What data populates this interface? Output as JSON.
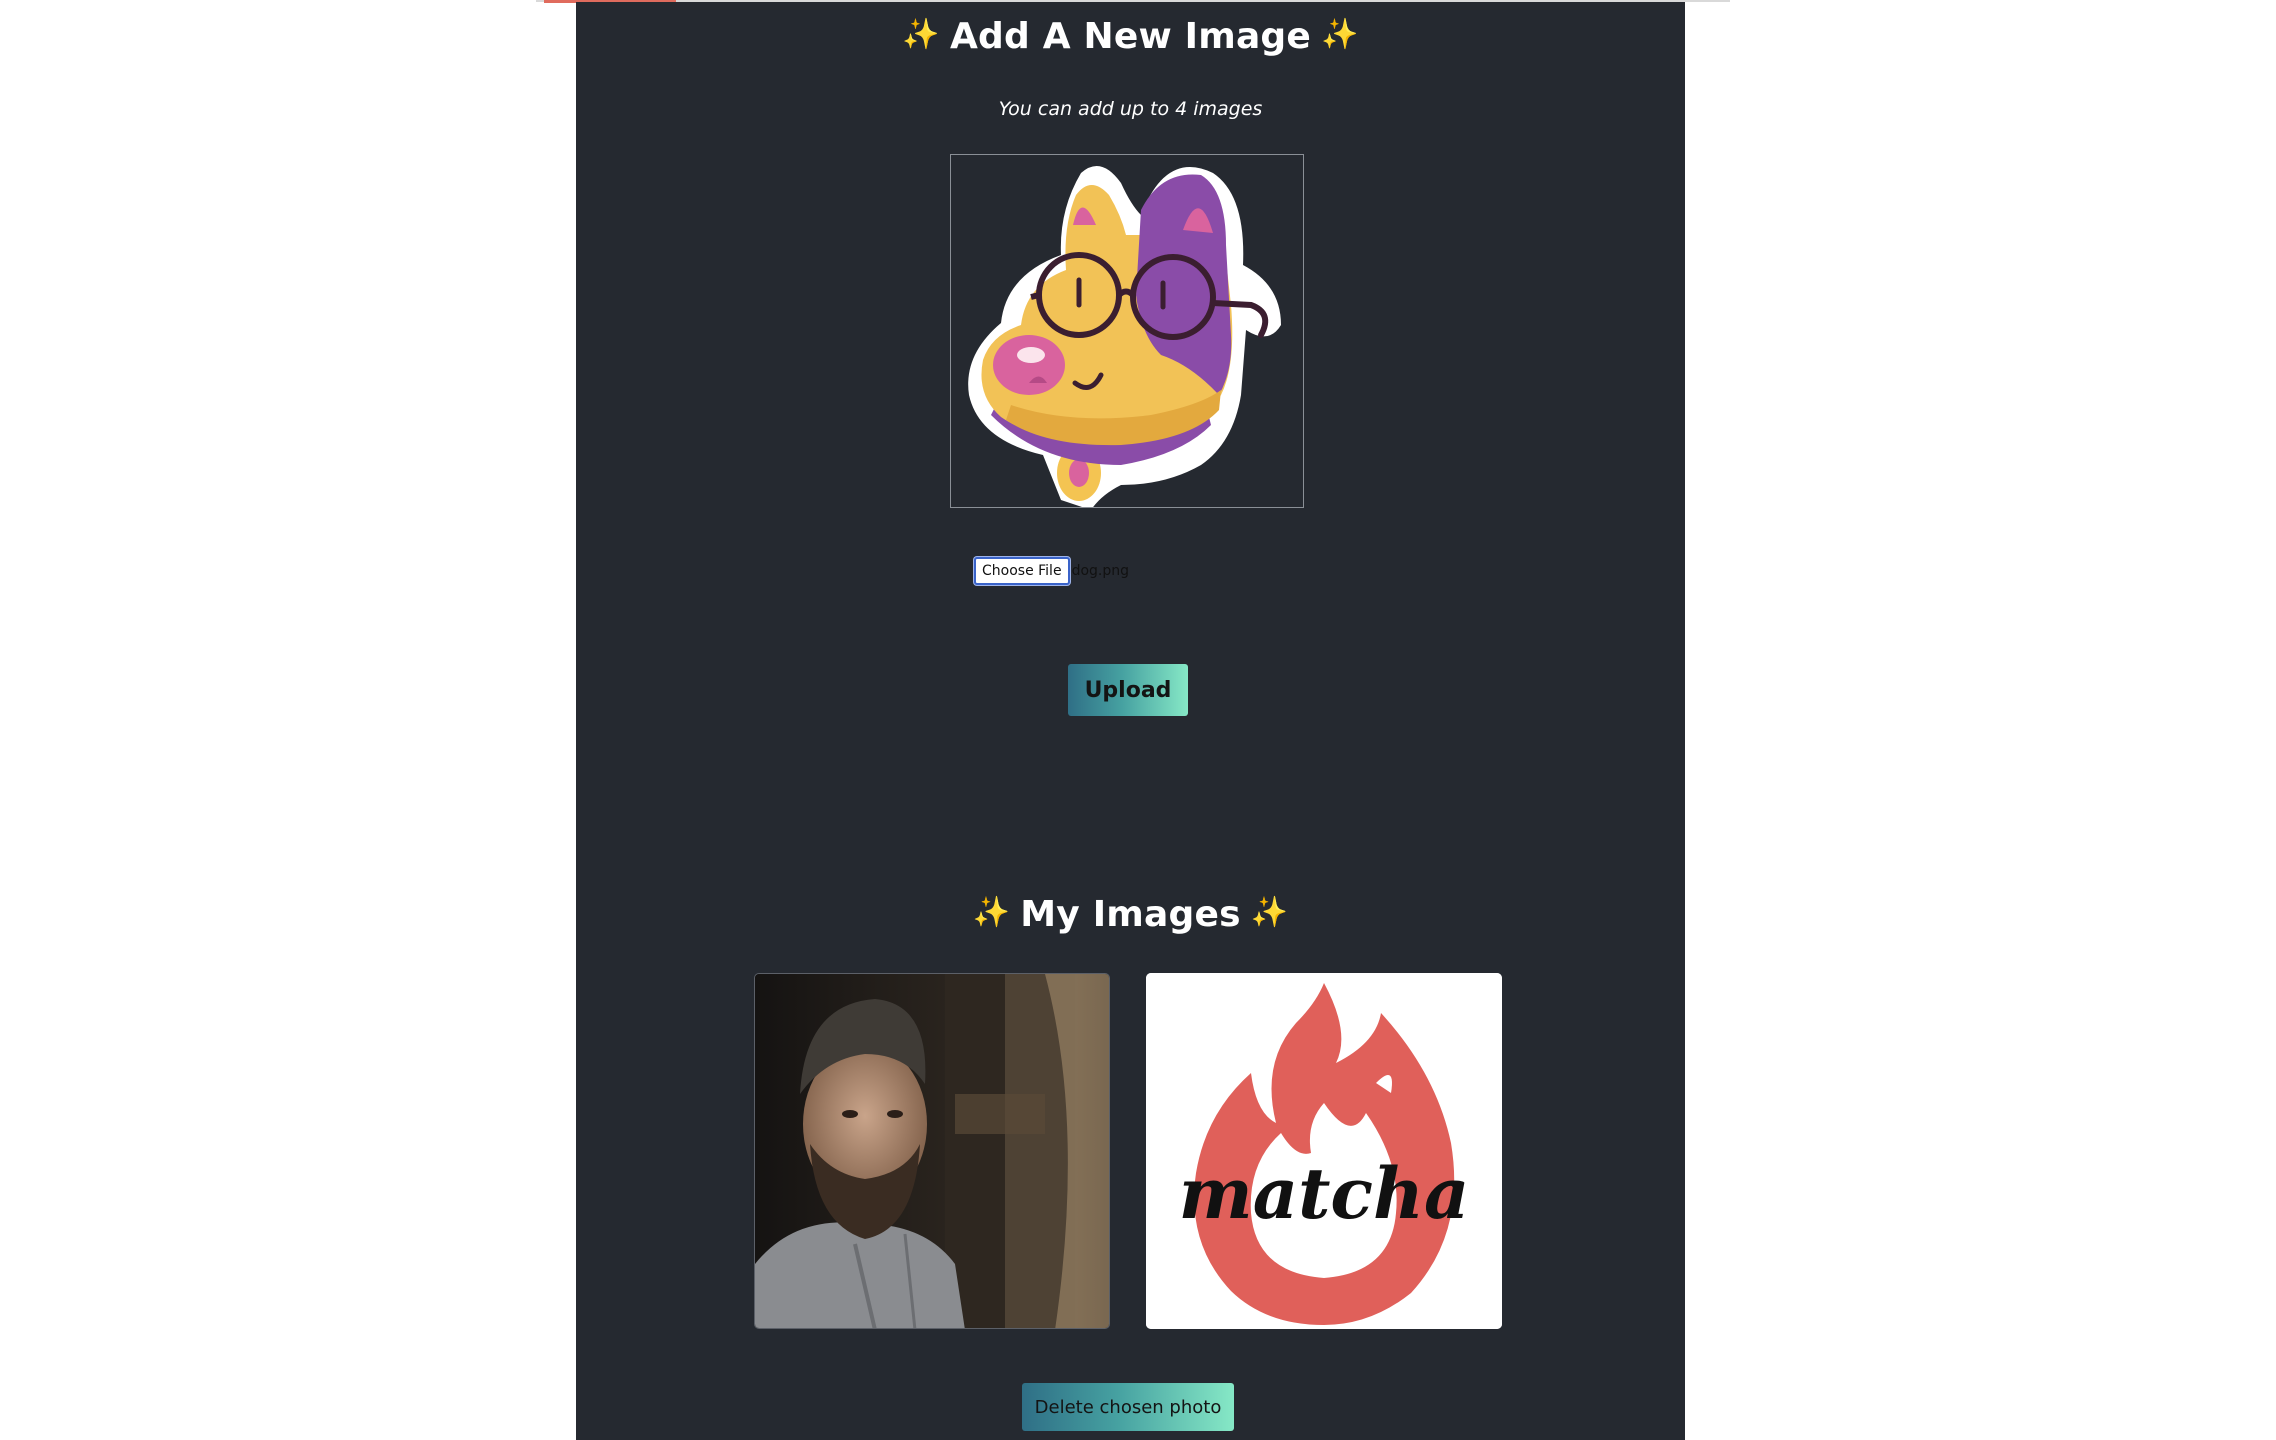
{
  "add_section": {
    "spark_left": "✨",
    "title": "Add A New Image",
    "spark_right": "✨",
    "subtitle": "You can add up to 4 images"
  },
  "file_input": {
    "button_label": "Choose File",
    "file_name": "dog.png"
  },
  "upload_button": {
    "label": "Upload"
  },
  "my_images": {
    "spark_left": "✨",
    "title": "My Images",
    "spark_right": "✨",
    "photos": [
      {
        "kind": "photo",
        "description_icon": "bearded-man-photo"
      },
      {
        "kind": "logo",
        "logo_text": "matcha",
        "logo_color": "#e0605a"
      }
    ]
  },
  "delete_button": {
    "label": "Delete chosen photo"
  },
  "colors": {
    "panel": "#252930",
    "accent_gradient_start": "#2f6f86",
    "accent_gradient_end": "#86e8c6",
    "spark": "#f4c84a"
  }
}
